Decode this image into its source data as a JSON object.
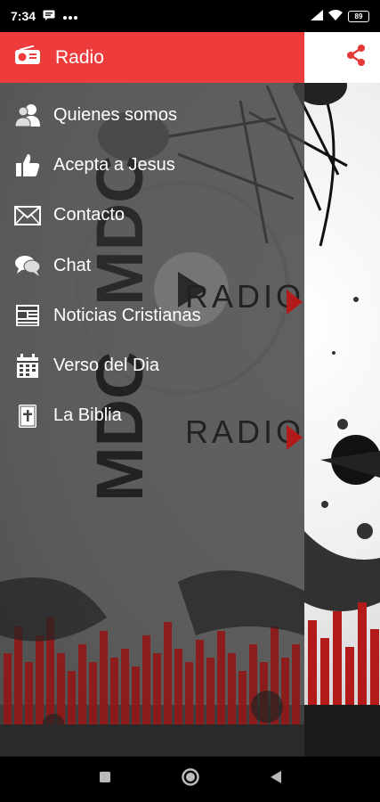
{
  "status_bar": {
    "time": "7:34",
    "battery": "89",
    "icons": [
      "chat-notification-icon",
      "more-dots-icon",
      "signal-icon",
      "wifi-icon",
      "battery-icon"
    ]
  },
  "app_bar": {
    "share_icon": "share-icon",
    "background_color": "#ffffff",
    "icon_color": "#e53935"
  },
  "drawer": {
    "header": {
      "label": "Radio",
      "icon": "radio-icon",
      "color": "#ee3c3c"
    },
    "items": [
      {
        "label": "Quienes somos",
        "icon": "users-icon"
      },
      {
        "label": "Acepta a Jesus",
        "icon": "thumbs-up-icon"
      },
      {
        "label": "Contacto",
        "icon": "mail-icon"
      },
      {
        "label": "Chat",
        "icon": "chat-icon"
      },
      {
        "label": "Noticias Cristianas",
        "icon": "newspaper-icon"
      },
      {
        "label": "Verso del Dia",
        "icon": "calendar-icon"
      },
      {
        "label": "La Biblia",
        "icon": "bible-icon"
      }
    ]
  },
  "watermark": {
    "logo_text": "MDC",
    "radio_text": "RADIO"
  },
  "nav_bar": {
    "icons": [
      "recents-square-icon",
      "home-circle-icon",
      "back-triangle-icon"
    ]
  }
}
